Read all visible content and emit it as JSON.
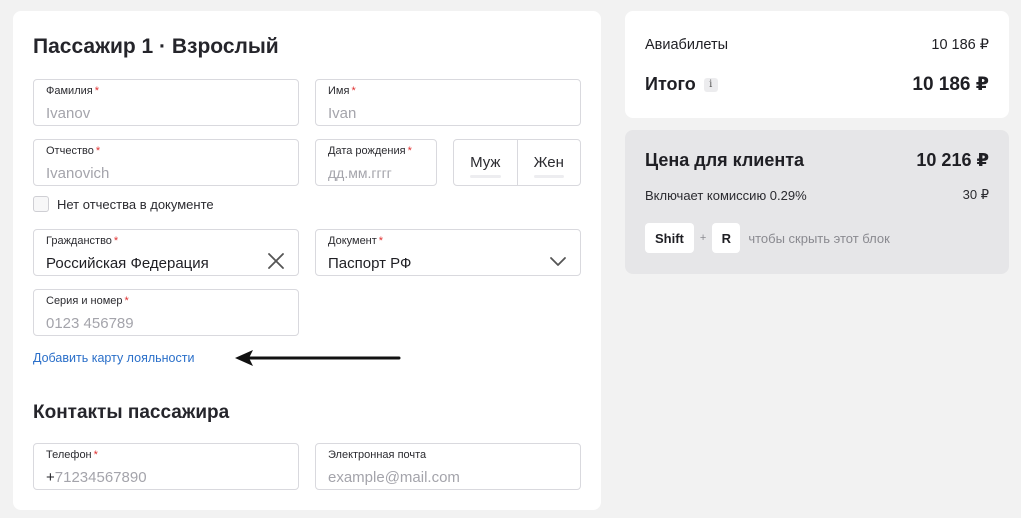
{
  "passenger": {
    "title": "Пассажир 1 · Взрослый",
    "fields": {
      "last_name": {
        "label": "Фамилия",
        "required": "*",
        "placeholder": "Ivanov"
      },
      "first_name": {
        "label": "Имя",
        "required": "*",
        "placeholder": "Ivan"
      },
      "middle_name": {
        "label": "Отчество",
        "required": "*",
        "placeholder": "Ivanovich"
      },
      "birth_date": {
        "label": "Дата рождения",
        "required": "*",
        "placeholder": "дд.мм.гггг"
      },
      "citizenship": {
        "label": "Гражданство",
        "required": "*",
        "value": "Российская Федерация"
      },
      "document": {
        "label": "Документ",
        "required": "*",
        "value": "Паспорт РФ"
      },
      "doc_number": {
        "label": "Серия и номер",
        "required": "*",
        "placeholder": "0123 456789"
      }
    },
    "gender": {
      "male": "Муж",
      "female": "Жен"
    },
    "no_middle_name_label": "Нет отчества в документе",
    "loyalty_link": "Добавить карту лояльности"
  },
  "contacts": {
    "title": "Контакты пассажира",
    "phone": {
      "label": "Телефон",
      "required": "*",
      "prefix": "+",
      "placeholder": "71234567890"
    },
    "email": {
      "label": "Электронная почта",
      "placeholder": "example@mail.com"
    }
  },
  "summary": {
    "tickets_label": "Авиабилеты",
    "tickets_value": "10 186 ₽",
    "total_label": "Итого",
    "info_icon": "i",
    "total_value": "10 186 ₽"
  },
  "client_price": {
    "title": "Цена для клиента",
    "value": "10 216 ₽",
    "commission_label": "Включает комиссию 0.29%",
    "commission_value": "30 ₽",
    "key1": "Shift",
    "plus": "+",
    "key2": "R",
    "hint": "чтобы скрыть этот блок"
  },
  "colors": {
    "link": "#2a6fc9",
    "required": "#e03131",
    "placeholder": "#a4a4ab"
  }
}
